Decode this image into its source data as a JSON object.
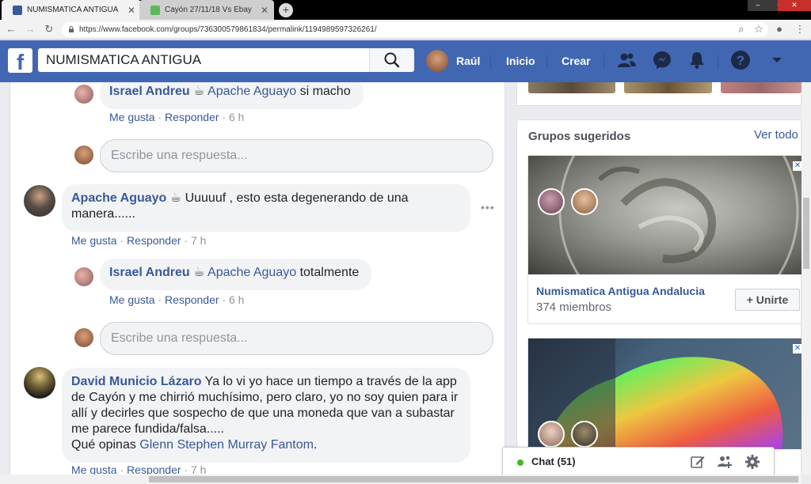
{
  "browser": {
    "tabs": [
      {
        "title": "NUMISMATICA ANTIGUA",
        "active": true
      },
      {
        "title": "Cayón 27/11/18 Vs Ebay",
        "active": false
      }
    ],
    "url": "https://www.facebook.com/groups/736300579861834/permalink/1194989597326261/"
  },
  "header": {
    "search_value": "NUMISMATICA ANTIGUA",
    "user_name": "Raúl",
    "nav": [
      "Inicio",
      "Crear"
    ]
  },
  "comments": [
    {
      "author": "Israel Andreu",
      "mention": "Apache Aguayo",
      "text": "si macho",
      "like": "Me gusta",
      "reply": "Responder",
      "time": "6 h"
    },
    {
      "author": "Apache Aguayo",
      "text": "Uuuuuf , esto esta degenerando de una manera......",
      "like": "Me gusta",
      "reply": "Responder",
      "time": "7 h"
    },
    {
      "author": "Israel Andreu",
      "mention": "Apache Aguayo",
      "text": "totalmente",
      "like": "Me gusta",
      "reply": "Responder",
      "time": "6 h"
    },
    {
      "author": "David Municio Lázaro",
      "text": "Ya lo vi yo hace un tiempo a través de la app de Cayón y me chirrió muchísimo, pero claro, yo no soy quien para ir allí y decirles que sospecho de que una moneda que van a subastar me parece fundida/falsa.....",
      "text2_prefix": "Qué opinas",
      "mention": "Glenn Stephen Murray Fantom",
      "text2_suffix": ".",
      "like": "Me gusta",
      "reply": "Responder",
      "time": "7 h"
    }
  ],
  "reply_placeholder": "Escribe una respuesta...",
  "sidebar": {
    "groups_title": "Grupos sugeridos",
    "see_all": "Ver todo",
    "group1": {
      "name": "Numismatica Antigua Andalucia",
      "members": "374 miembros",
      "join": "+ Unirte"
    }
  },
  "chat": {
    "label": "Chat (51)"
  },
  "colors": {
    "fb_blue": "#4267b2",
    "link": "#385898",
    "online": "#42b72a"
  }
}
